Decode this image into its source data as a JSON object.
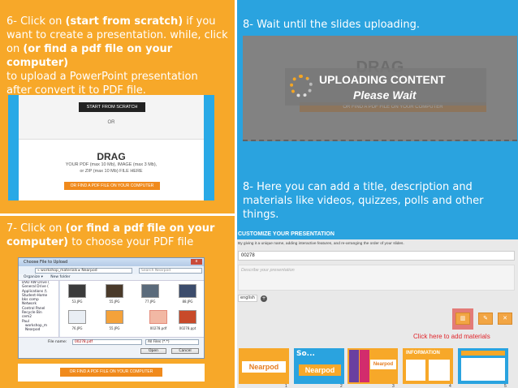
{
  "step6": {
    "line1_pre": "6- Click on ",
    "line1_bold": "(start from scratch)",
    "line1_post": " if you",
    "line2": "want to create a presentation. while, click",
    "line3_pre": "on ",
    "line3_bold": "(or find a pdf file on your computer)",
    "line4": "to upload a PowerPoint presentation",
    "line5": "after convert it to PDF file.",
    "panel": {
      "start_button": "START FROM SCRATCH",
      "or_label": "OR",
      "drag_label": "DRAG",
      "sub_line1": "YOUR PDF (max 10 Mb), IMAGE (max 3 Mb),",
      "sub_line2": "or ZIP (max 10 Mb) FILE HERE",
      "find_button": "OR FIND A PDF FILE ON YOUR COMPUTER"
    }
  },
  "step7": {
    "line1_pre": "7- Click on ",
    "line1_bold": "(or find a pdf file on your",
    "line2_bold": "computer)",
    "line2_post": " to choose your PDF file",
    "dialog": {
      "title": "Choose File to Upload",
      "close": "x",
      "path": "« workshop_materials ▸ Nearpod",
      "search": "Search Nearpod",
      "organize": "Organize ▾",
      "new_folder": "New folder",
      "tree": [
        "DVD RW Drive (",
        "General Drive (",
        "Applications (\\",
        "Student-Home",
        "bks comp",
        "Network",
        "Control Panel",
        "Recycle Bin",
        "cem2",
        "Paul",
        "workshop_m",
        "Nearpod"
      ],
      "files": [
        "53.JPG",
        "55.JPG",
        "77.JPG",
        "00278.pdf",
        "00278.ppt",
        "76.JPG",
        "55.JPG",
        "88.JPG"
      ],
      "filename_label": "File name:",
      "filename_value": "00278.pdf",
      "filter": "All Files (*.*)",
      "open_button": "Open",
      "cancel_button": "Cancel"
    },
    "find_button": "OR FIND A PDF FILE ON YOUR COMPUTER"
  },
  "step8a": {
    "text": "8- Wait until the slides uploading.",
    "drag_label": "DRAG",
    "msg1": "UPLOADING CONTENT",
    "msg2": "Please Wait",
    "faded_button": "OR FIND A PDF FILE ON YOUR COMPUTER"
  },
  "step8b": {
    "line1": "8- Here you can add a title, description and",
    "line2": "materials like videos, quizzes, polls and other",
    "line3": "things.",
    "panel": {
      "header": "CUSTOMIZE YOUR PRESENTATION",
      "sub": "By giving it a unique name, adding interactive features, and re-arranging the order of your slides.",
      "title_value": "00278",
      "desc_placeholder": "Describe your presentation",
      "lang": "english",
      "lang_add": "+",
      "tool_add": "▥",
      "tool_edit": "✎",
      "tool_delete": "✕",
      "callout": "Click here to add materials",
      "slides": [
        {
          "num": "1",
          "label": "Nearpod"
        },
        {
          "num": "2",
          "label": "Nearpod"
        },
        {
          "num": "3",
          "label": "Nearpod"
        },
        {
          "num": "4",
          "label": "INFORMATION"
        },
        {
          "num": "5",
          "label": ""
        }
      ]
    }
  },
  "colors": {
    "orange": "#f7a829",
    "blue": "#2aa3df",
    "callout_red": "#e0262c",
    "button_orange": "#f08a1c"
  }
}
